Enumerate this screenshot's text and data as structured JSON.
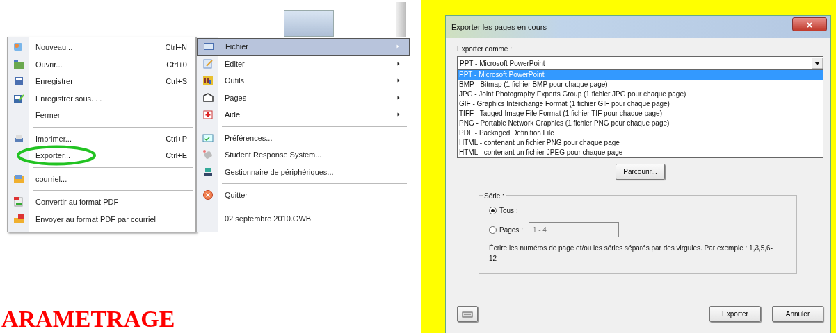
{
  "file_menu": {
    "items": [
      {
        "kind": "item",
        "label": "Nouveau...",
        "shortcut": "Ctrl+N"
      },
      {
        "kind": "item",
        "label": "Ouvrir...",
        "shortcut": "Ctrl+0"
      },
      {
        "kind": "item",
        "label": "Enregistrer",
        "shortcut": "Ctrl+S"
      },
      {
        "kind": "item",
        "label": "Enregistrer sous. . ."
      },
      {
        "kind": "item",
        "label": "Fermer"
      },
      {
        "kind": "separator"
      },
      {
        "kind": "item",
        "label": "Imprimer...",
        "shortcut": "Ctrl+P"
      },
      {
        "kind": "item",
        "label": "Exporter...",
        "shortcut": "Ctrl+E",
        "circled": true
      },
      {
        "kind": "separator"
      },
      {
        "kind": "item",
        "label": "courriel..."
      },
      {
        "kind": "separator"
      },
      {
        "kind": "item",
        "label": "Convertir au format PDF"
      },
      {
        "kind": "item",
        "label": "Envoyer au format PDF par courriel"
      }
    ]
  },
  "main_menu": {
    "items": [
      {
        "kind": "item",
        "label": "Fichier",
        "submenu": true,
        "selected": true
      },
      {
        "kind": "item",
        "label": "Éditer",
        "submenu": true,
        "selected": false
      },
      {
        "kind": "item",
        "label": "Outils",
        "submenu": true,
        "selected": false
      },
      {
        "kind": "item",
        "label": "Pages",
        "submenu": true,
        "selected": false
      },
      {
        "kind": "item",
        "label": "Aide",
        "submenu": true,
        "selected": false
      },
      {
        "kind": "separator"
      },
      {
        "kind": "item",
        "label": "Préférences...",
        "submenu": false,
        "selected": false
      },
      {
        "kind": "item",
        "label": "Student Response System...",
        "submenu": false,
        "selected": false
      },
      {
        "kind": "item",
        "label": "Gestionnaire de périphériques...",
        "submenu": false,
        "selected": false
      },
      {
        "kind": "separator"
      },
      {
        "kind": "item",
        "label": "Quitter",
        "submenu": false,
        "selected": false
      },
      {
        "kind": "separator"
      },
      {
        "kind": "item",
        "label": "02 septembre 2010.GWB",
        "submenu": false,
        "selected": false
      }
    ]
  },
  "heading": "ARAMETRAGE",
  "dialog": {
    "title": "Exporter les pages en cours",
    "export_as_label": "Exporter comme :",
    "export_as_value": "PPT - Microsoft PowerPoint",
    "options": [
      {
        "label": "PPT - Microsoft PowerPoint",
        "selected": true
      },
      {
        "label": "BMP - Bitmap (1 fichier BMP pour chaque page)",
        "selected": false
      },
      {
        "label": "JPG - Joint Photography Experts Group (1 fichier JPG pour chaque page)",
        "selected": false
      },
      {
        "label": "GIF - Graphics Interchange Format (1 fichier GIF pour chaque page)",
        "selected": false
      },
      {
        "label": "TIFF - Tagged Image File Format (1 fichier TIF pour chaque page)",
        "selected": false
      },
      {
        "label": "PNG - Portable Network Graphics (1 fichier PNG pour chaque page)",
        "selected": false
      },
      {
        "label": "PDF - Packaged Definition File",
        "selected": false
      },
      {
        "label": "HTML - contenant un fichier PNG pour chaque page",
        "selected": false
      },
      {
        "label": "HTML - contenant un fichier JPEG pour chaque page",
        "selected": false
      }
    ],
    "browse_button": "Parcourir...",
    "range": {
      "legend": "Série :",
      "options": [
        {
          "label": "Tous :",
          "selected": true
        },
        {
          "label": "Pages :",
          "selected": false
        }
      ],
      "pages_value": "1 - 4",
      "hint": "Écrire les numéros de page et/ou les séries séparés par des virgules. Par exemple : 1,3,5,6-12"
    },
    "buttons": [
      "Exporter",
      "Annuler"
    ]
  }
}
